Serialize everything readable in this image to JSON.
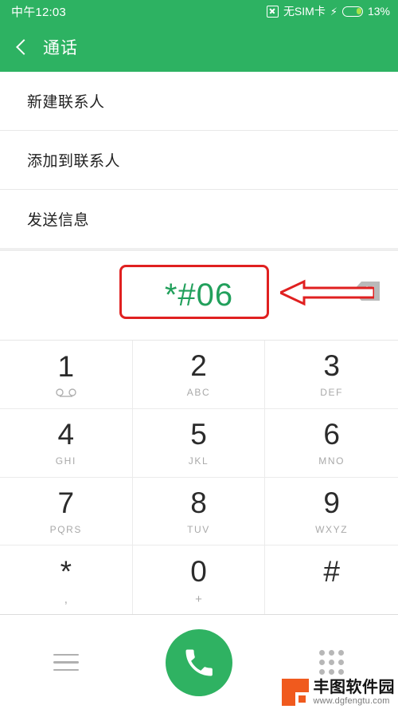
{
  "status_bar": {
    "time": "中午12:03",
    "sim_text": "无SIM卡",
    "battery_percent": "13%",
    "charging_icon": "⚡",
    "no_sim_icon": "no-sim-icon"
  },
  "app_bar": {
    "back_icon": "chevron-left-icon",
    "title": "通话"
  },
  "list": {
    "items": [
      {
        "label": "新建联系人"
      },
      {
        "label": "添加到联系人"
      },
      {
        "label": "发送信息"
      }
    ]
  },
  "dialer": {
    "number": "*#06",
    "backspace_icon": "backspace-icon",
    "keys": [
      {
        "digit": "1",
        "sub": "",
        "icon": "voicemail-icon"
      },
      {
        "digit": "2",
        "sub": "ABC",
        "icon": ""
      },
      {
        "digit": "3",
        "sub": "DEF",
        "icon": ""
      },
      {
        "digit": "4",
        "sub": "GHI",
        "icon": ""
      },
      {
        "digit": "5",
        "sub": "JKL",
        "icon": ""
      },
      {
        "digit": "6",
        "sub": "MNO",
        "icon": ""
      },
      {
        "digit": "7",
        "sub": "PQRS",
        "icon": ""
      },
      {
        "digit": "8",
        "sub": "TUV",
        "icon": ""
      },
      {
        "digit": "9",
        "sub": "WXYZ",
        "icon": ""
      },
      {
        "digit": "*",
        "sub": ",",
        "icon": ""
      },
      {
        "digit": "0",
        "sub": "+",
        "icon": ""
      },
      {
        "digit": "#",
        "sub": "",
        "icon": ""
      }
    ]
  },
  "bottom_bar": {
    "menu_icon": "hamburger-menu-icon",
    "call_icon": "phone-handset-icon",
    "keypad_icon": "dialpad-grid-icon"
  },
  "annotations": {
    "highlight_target": "*#06",
    "arrow_points_to": "backspace-icon"
  },
  "watermark": {
    "name": "丰图软件园",
    "url": "www.dgfengtu.com"
  },
  "colors": {
    "brand_green": "#2db262",
    "number_green": "#22a05c",
    "annotation_red": "#e02020",
    "watermark_orange": "#f05a1e"
  }
}
